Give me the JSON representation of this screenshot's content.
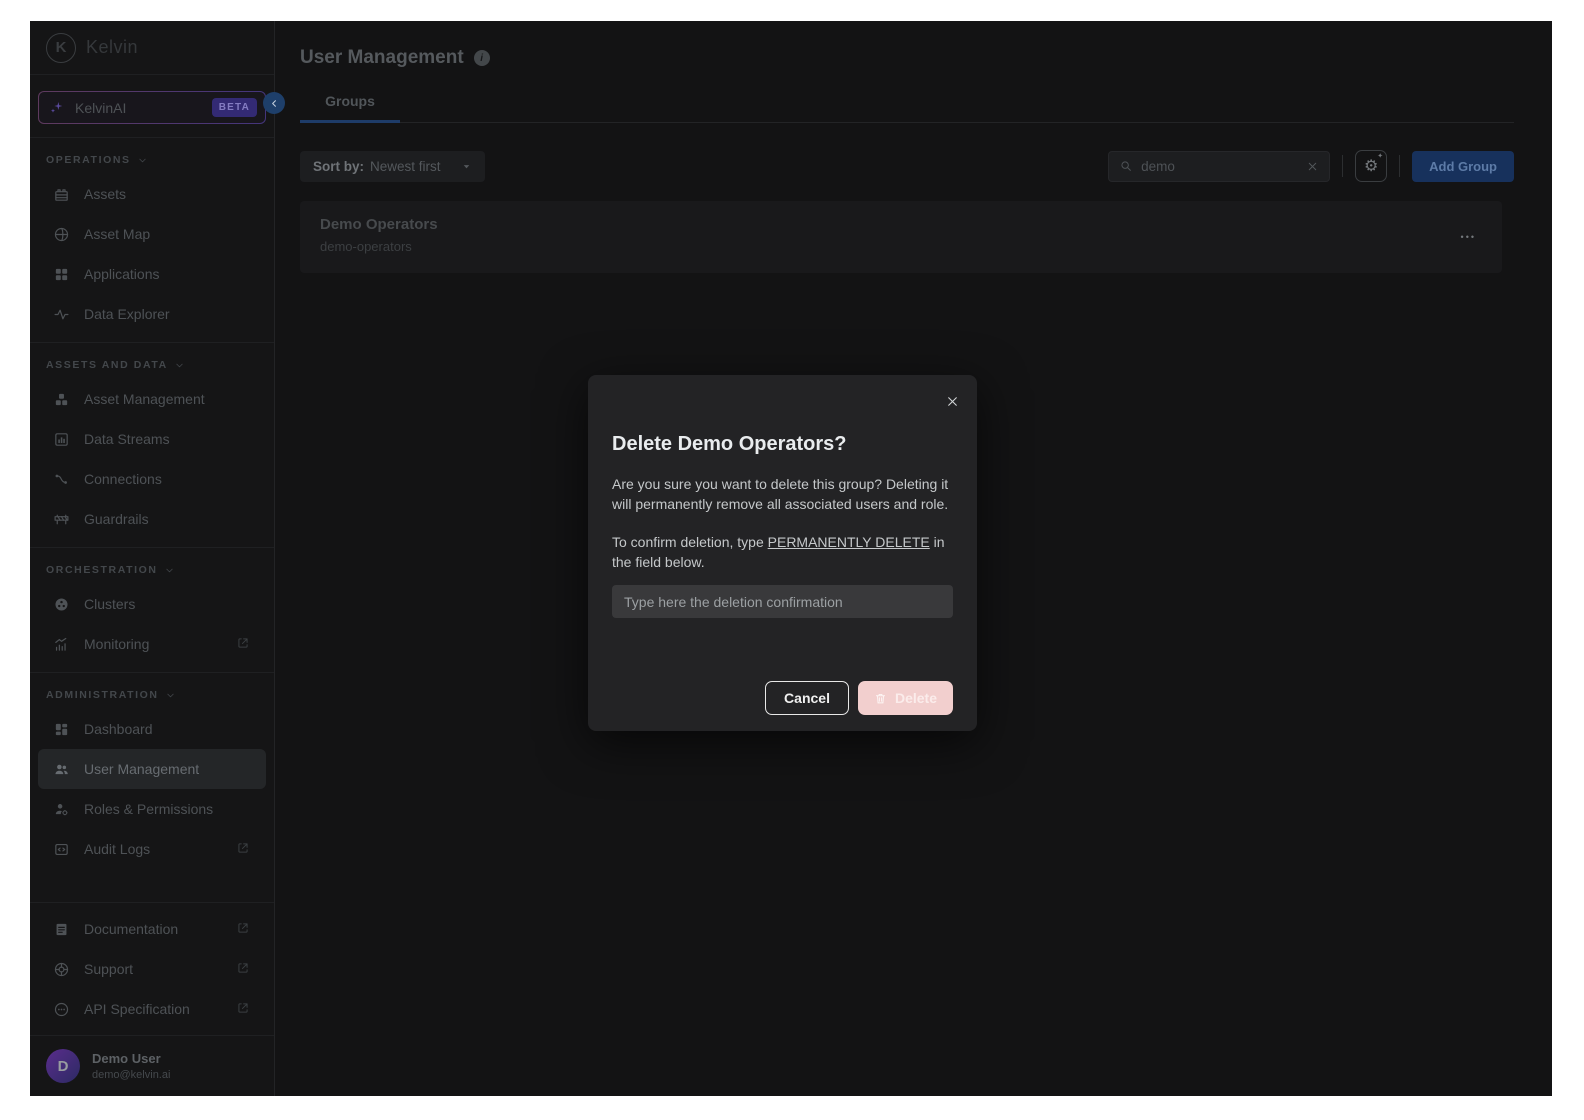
{
  "brand": {
    "name": "Kelvin",
    "logo_letter": "K"
  },
  "sidebar": {
    "ai": {
      "label": "KelvinAI",
      "badge": "BETA"
    },
    "sections": [
      {
        "label": "OPERATIONS",
        "items": [
          {
            "label": "Assets"
          },
          {
            "label": "Asset Map"
          },
          {
            "label": "Applications"
          },
          {
            "label": "Data Explorer"
          }
        ]
      },
      {
        "label": "ASSETS AND DATA",
        "items": [
          {
            "label": "Asset Management"
          },
          {
            "label": "Data Streams"
          },
          {
            "label": "Connections"
          },
          {
            "label": "Guardrails"
          }
        ]
      },
      {
        "label": "ORCHESTRATION",
        "items": [
          {
            "label": "Clusters"
          },
          {
            "label": "Monitoring",
            "external": true
          }
        ]
      },
      {
        "label": "ADMINISTRATION",
        "items": [
          {
            "label": "Dashboard"
          },
          {
            "label": "User Management",
            "active": true
          },
          {
            "label": "Roles & Permissions"
          },
          {
            "label": "Audit Logs",
            "external": true
          }
        ]
      }
    ],
    "links": [
      {
        "label": "Documentation"
      },
      {
        "label": "Support"
      },
      {
        "label": "API Specification"
      }
    ],
    "user": {
      "initial": "D",
      "name": "Demo User",
      "email": "demo@kelvin.ai"
    }
  },
  "header": {
    "title": "User Management",
    "tab": "Groups"
  },
  "toolbar": {
    "sort_label": "Sort by:",
    "sort_value": "Newest first",
    "search_value": "demo",
    "add_group": "Add Group"
  },
  "groups": [
    {
      "name": "Demo Operators",
      "slug": "demo-operators"
    }
  ],
  "modal": {
    "title": "Delete Demo Operators?",
    "body": "Are you sure you want to delete this group? Deleting it will permanently remove all associated users and role.",
    "confirm_prefix": "To confirm deletion, type ",
    "confirm_keyword": "PERMANENTLY DELETE",
    "confirm_suffix": " in the field below.",
    "placeholder": "Type here the deletion confirmation",
    "cancel": "Cancel",
    "delete": "Delete"
  },
  "icons": {
    "settings_gear": "⚙",
    "settings_spark": "✦",
    "row_menu": "•••",
    "info": "i"
  },
  "colors": {
    "accent_blue": "#1e3c69",
    "danger_pink": "#f2cfce",
    "beta_purple": "#332a74"
  }
}
